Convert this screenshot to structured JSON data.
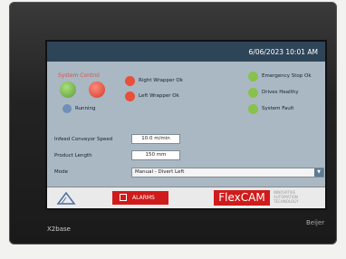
{
  "status_bar": {
    "datetime": "6/06/2023 10:01 AM"
  },
  "system_control": {
    "title": "System Control",
    "running_label": "Running"
  },
  "indicators": {
    "right_wrapper": "Right Wrapper Ok",
    "left_wrapper": "Left Wrapper Ok",
    "estop": "Emergency Stop Ok",
    "drives": "Drives Healthy",
    "system_fault": "System Fault"
  },
  "settings": {
    "speed_label": "Infeed Conveyor Speed",
    "speed_value": "10.0 m/min",
    "length_label": "Product Length",
    "length_value": "150 mm",
    "mode_label": "Mode",
    "mode_value": "Manual - Divert Left"
  },
  "footer": {
    "alarms_label": "ALARMS",
    "brand": "FlexCAM",
    "tagline": [
      "INNOVATIVE",
      "AUTOMATION",
      "TECHNOLOGY"
    ]
  },
  "device": {
    "model": "X2base",
    "maker": "Beijer"
  },
  "colors": {
    "header": "#2e4558",
    "screen_bg": "#a9b8c3",
    "alarm": "#d01b1b",
    "ok_green": "#88c24a"
  },
  "icons": [
    "logo-icon",
    "alarm-bell-icon",
    "dropdown-arrow-icon"
  ]
}
